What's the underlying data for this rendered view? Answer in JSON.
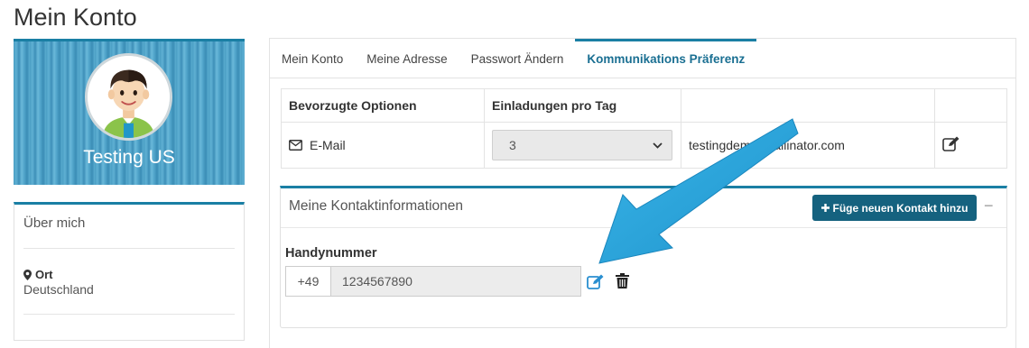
{
  "page": {
    "title": "Mein Konto"
  },
  "profile": {
    "name": "Testing US"
  },
  "about": {
    "title": "Über mich",
    "location_label": "Ort",
    "location_value": "Deutschland"
  },
  "tabs": [
    {
      "label": "Mein Konto"
    },
    {
      "label": "Meine Adresse"
    },
    {
      "label": "Passwort Ändern"
    },
    {
      "label": "Kommunikations Präferenz"
    }
  ],
  "preferences": {
    "col_options": "Bevorzugte Optionen",
    "col_invites": "Einladungen pro Tag",
    "row": {
      "option": "E-Mail",
      "invites": "3",
      "email": "testingdem@mailinator.com"
    }
  },
  "contact": {
    "title": "Meine Kontaktinformationen",
    "add_button": "Füge neuen Kontakt hinzu",
    "collapse": "−",
    "phone_label": "Handynummer",
    "phone_prefix": "+49",
    "phone_number": "1234567890"
  },
  "colors": {
    "accent": "#1a7fa4",
    "button": "#15627f",
    "arrow": "#29a7dd"
  }
}
